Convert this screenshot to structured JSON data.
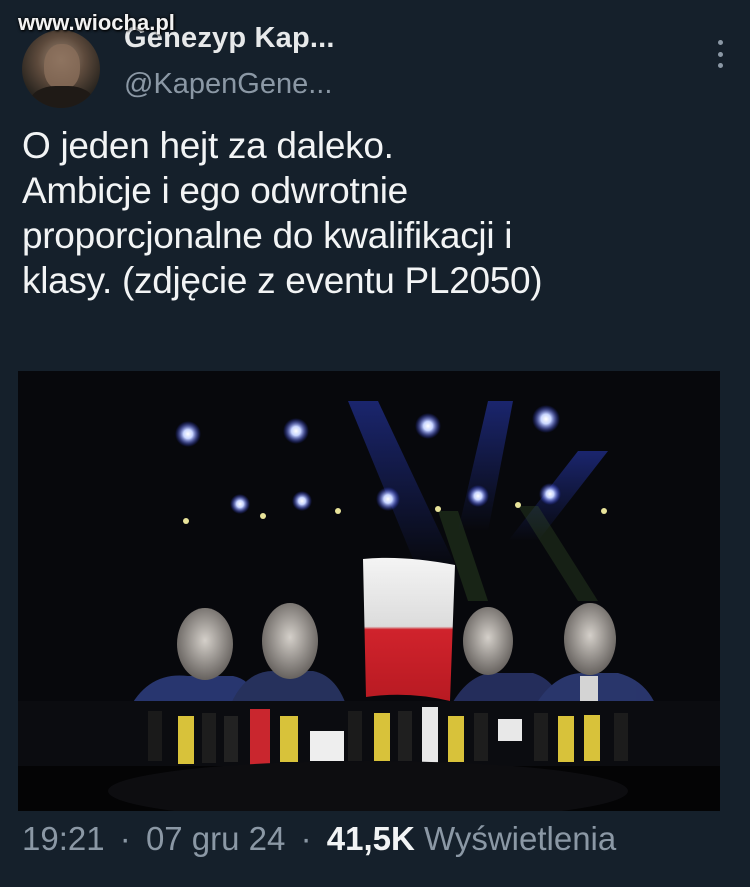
{
  "watermark": "www.wiocha.pl",
  "author": {
    "display_name": "Genezyp Kap...",
    "handle": "@KapenGene..."
  },
  "tweet": {
    "lines": [
      "O jeden hejt za daleko.",
      "Ambicje i ego odwrotnie",
      "proporcjonalne do kwalifikacji i",
      "klasy. (zdjęcie z eventu PL2050)"
    ]
  },
  "meta": {
    "time": "19:21",
    "separator": "·",
    "date": "07 gru 24",
    "views_count": "41,5K",
    "views_label": "Wyświetlenia"
  },
  "icons": [
    "more-vertical-icon"
  ],
  "colors": {
    "background": "#15202b",
    "text": "#e7e9ea",
    "secondary": "#8b98a5"
  }
}
